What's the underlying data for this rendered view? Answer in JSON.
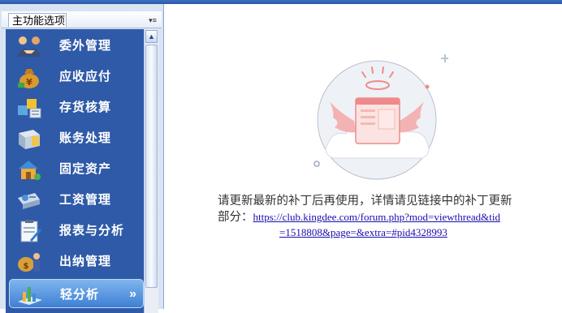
{
  "panel": {
    "title": "主功能选项",
    "menu_button": "▾≡"
  },
  "nav": {
    "items": [
      {
        "label": "委外管理",
        "icon": "outsourcing-handshake-icon"
      },
      {
        "label": "应收应付",
        "icon": "money-bag-icon"
      },
      {
        "label": "存货核算",
        "icon": "inventory-boxes-icon"
      },
      {
        "label": "账务处理",
        "icon": "ledger-book-icon"
      },
      {
        "label": "固定资产",
        "icon": "house-asset-icon"
      },
      {
        "label": "工资管理",
        "icon": "salary-card-icon"
      },
      {
        "label": "报表与分析",
        "icon": "report-clipboard-icon"
      },
      {
        "label": "出纳管理",
        "icon": "cashier-person-icon"
      },
      {
        "label": "轻分析",
        "icon": "light-analysis-chart-icon",
        "active": true,
        "suffix": "»"
      }
    ]
  },
  "main": {
    "message_line1": "请更新最新的补丁后再使用，详情请见链接中的补丁更新",
    "message_line2_prefix": "部分：",
    "link_part1": "https://club.kingdee.com/forum.php?mod=viewthread&tid",
    "link_part2": "=1518808&page=&extra=#pid4328993"
  },
  "colors": {
    "nav_bg": "#2f5aa8",
    "active_item": "#5b9be2",
    "illustration_accent": "#f08a8a",
    "illustration_circle": "#eef1f6"
  }
}
